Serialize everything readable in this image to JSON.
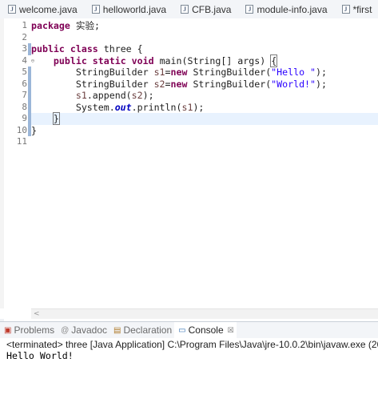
{
  "editor_tabs": [
    {
      "label": "welcome.java"
    },
    {
      "label": "helloworld.java"
    },
    {
      "label": "CFB.java"
    },
    {
      "label": "module-info.java"
    },
    {
      "label": "*first"
    }
  ],
  "editor": {
    "line_numbers": [
      "1",
      "2",
      "3",
      "4",
      "5",
      "6",
      "7",
      "8",
      "9",
      "10",
      "11"
    ],
    "current_line": "9",
    "hscroll_arrow": "<"
  },
  "panel": {
    "tabs": [
      {
        "label": "Problems",
        "icon": "problems-icon"
      },
      {
        "label": "Javadoc",
        "icon": "javadoc-icon"
      },
      {
        "label": "Declaration",
        "icon": "declaration-icon"
      },
      {
        "label": "Console",
        "icon": "console-icon"
      }
    ],
    "close_glyph": "☒"
  },
  "console": {
    "terminated": "<terminated> three [Java Application] C:\\Program Files\\Java\\jre-10.0.2\\bin\\javaw.exe (20",
    "output": "Hello World!"
  },
  "colors": {
    "keyword": "#7f0055",
    "string": "#2a00ff",
    "local_variable": "#6a3e3e",
    "static_field": "#0000c0",
    "current_line_bg": "#e8f2fe"
  }
}
